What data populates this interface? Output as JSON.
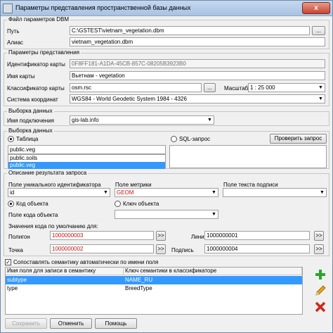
{
  "window": {
    "title": "Параметры представления пространственной базы данных",
    "close_glyph": "x"
  },
  "dbm_file": {
    "group_title": "Файл параметров DBM",
    "path_label": "Путь",
    "path_value": "C:\\GSTEST\\vietnam_vegetation.dbm",
    "alias_label": "Алиас",
    "alias_value": "vietnam_vegetation.dbm",
    "browse_label": "..."
  },
  "view_params": {
    "group_title": "Параметры представления",
    "map_id_label": "Идентификатор карты",
    "map_id_value": "0F8FF181-A1DA-45CB-857C-08205B3923B0",
    "map_name_label": "Имя карты",
    "map_name_value": "Вьетнам - vegetation",
    "classifier_label": "Классификатор карты",
    "classifier_value": "osm.rsc",
    "scale_label": "Масштаб",
    "scale_value": "1 : 25 000",
    "coord_label": "Система координат",
    "coord_value": "WGS84 - World Geodetic System 1984 - 4326"
  },
  "data_selection": {
    "group_title": "Выборка данных",
    "connection_label": "Имя подключения",
    "connection_value": "gis-lab.info"
  },
  "query": {
    "group_title": "Выборка данных",
    "table_radio": "Таблица",
    "sql_radio": "SQL-запрос",
    "check_btn": "Проверить запрос",
    "table_input": "public.veg",
    "tables": [
      "public.soils",
      "public.veg"
    ],
    "selected_table": "public.veg"
  },
  "result": {
    "group_title": "Описание результата запроса",
    "uid_label": "Поле уникального идентификатора",
    "uid_value": "id",
    "metric_label": "Поле метрики",
    "metric_value": "GEOM",
    "label_field_label": "Поле текста подписи",
    "label_field_value": "",
    "object_code_radio": "Код объекта",
    "object_key_radio": "Ключ объекта",
    "object_code_field_label": "Поле кода объекта",
    "object_code_field_value": "",
    "defaults_label": "Значения кода по умолчанию для:",
    "polygon_label": "Полигон",
    "polygon_value": "1000000003",
    "line_label": "Линия",
    "line_value": "1000000001",
    "point_label": "Точка",
    "point_value": "1000000002",
    "caption_label": "Подпись",
    "caption_value": "1000000004",
    "pick_btn": ">>"
  },
  "semantics": {
    "auto_map_label": "Сопоставлять семантику автоматически по имени поля",
    "auto_map_checked": "✓",
    "columns": [
      "Имя поля для записи в семантику",
      "Ключ семантики в классификаторе"
    ],
    "rows": [
      {
        "field": "subtype",
        "key": "NAME_RU"
      },
      {
        "field": "type",
        "key": "BreedType"
      }
    ],
    "selected_row": 0
  },
  "footer": {
    "save_label": "Сохранить",
    "cancel_label": "Отменить",
    "help_label": "Помощь"
  },
  "colors": {
    "selection": "#3399ff",
    "red_value": "#d01010",
    "add_icon": "#2aa52a",
    "delete_icon": "#d0281c"
  }
}
